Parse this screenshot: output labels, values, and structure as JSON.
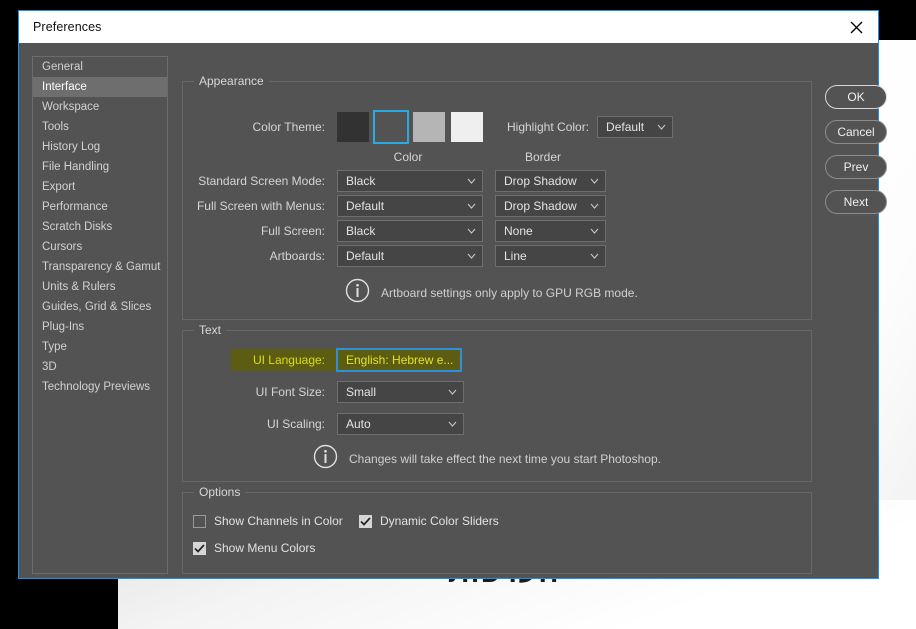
{
  "window": {
    "title": "Preferences",
    "close_icon": "close-icon"
  },
  "background": {
    "clipped_text": "העדפות"
  },
  "sidebar": {
    "items": [
      {
        "label": "General",
        "selected": false
      },
      {
        "label": "Interface",
        "selected": true
      },
      {
        "label": "Workspace",
        "selected": false
      },
      {
        "label": "Tools",
        "selected": false
      },
      {
        "label": "History Log",
        "selected": false
      },
      {
        "label": "File Handling",
        "selected": false
      },
      {
        "label": "Export",
        "selected": false
      },
      {
        "label": "Performance",
        "selected": false
      },
      {
        "label": "Scratch Disks",
        "selected": false
      },
      {
        "label": "Cursors",
        "selected": false
      },
      {
        "label": "Transparency & Gamut",
        "selected": false
      },
      {
        "label": "Units & Rulers",
        "selected": false
      },
      {
        "label": "Guides, Grid & Slices",
        "selected": false
      },
      {
        "label": "Plug-Ins",
        "selected": false
      },
      {
        "label": "Type",
        "selected": false
      },
      {
        "label": "3D",
        "selected": false
      },
      {
        "label": "Technology Previews",
        "selected": false
      }
    ]
  },
  "appearance": {
    "group_title": "Appearance",
    "color_theme_label": "Color Theme:",
    "swatches": [
      {
        "name": "theme-darkest",
        "color": "#323232",
        "selected": false
      },
      {
        "name": "theme-dark",
        "color": "#535353",
        "selected": true
      },
      {
        "name": "theme-light",
        "color": "#b5b5b5",
        "selected": false
      },
      {
        "name": "theme-lightest",
        "color": "#efefef",
        "selected": false
      }
    ],
    "highlight_color_label": "Highlight Color:",
    "highlight_color_value": "Default",
    "column_color": "Color",
    "column_border": "Border",
    "rows": [
      {
        "label": "Standard Screen Mode:",
        "color": "Black",
        "border": "Drop Shadow"
      },
      {
        "label": "Full Screen with Menus:",
        "color": "Default",
        "border": "Drop Shadow"
      },
      {
        "label": "Full Screen:",
        "color": "Black",
        "border": "None"
      },
      {
        "label": "Artboards:",
        "color": "Default",
        "border": "Line"
      }
    ],
    "note": "Artboard settings only apply to GPU RGB mode."
  },
  "text_section": {
    "group_title": "Text",
    "ui_language_label": "UI Language:",
    "ui_language_value": "English: Hebrew e...",
    "ui_font_size_label": "UI Font Size:",
    "ui_font_size_value": "Small",
    "ui_scaling_label": "UI Scaling:",
    "ui_scaling_value": "Auto",
    "note": "Changes will take effect the next time you start Photoshop.",
    "highlight_bg": "#5c5c12",
    "highlight_fg": "#dcdc16",
    "focus_ring": "#2f8fd8"
  },
  "options": {
    "group_title": "Options",
    "items": [
      {
        "label": "Show Channels in Color",
        "checked": false
      },
      {
        "label": "Dynamic Color Sliders",
        "checked": true
      },
      {
        "label": "Show Menu Colors",
        "checked": true
      }
    ]
  },
  "buttons": {
    "ok": "OK",
    "cancel": "Cancel",
    "prev": "Prev",
    "next": "Next"
  }
}
